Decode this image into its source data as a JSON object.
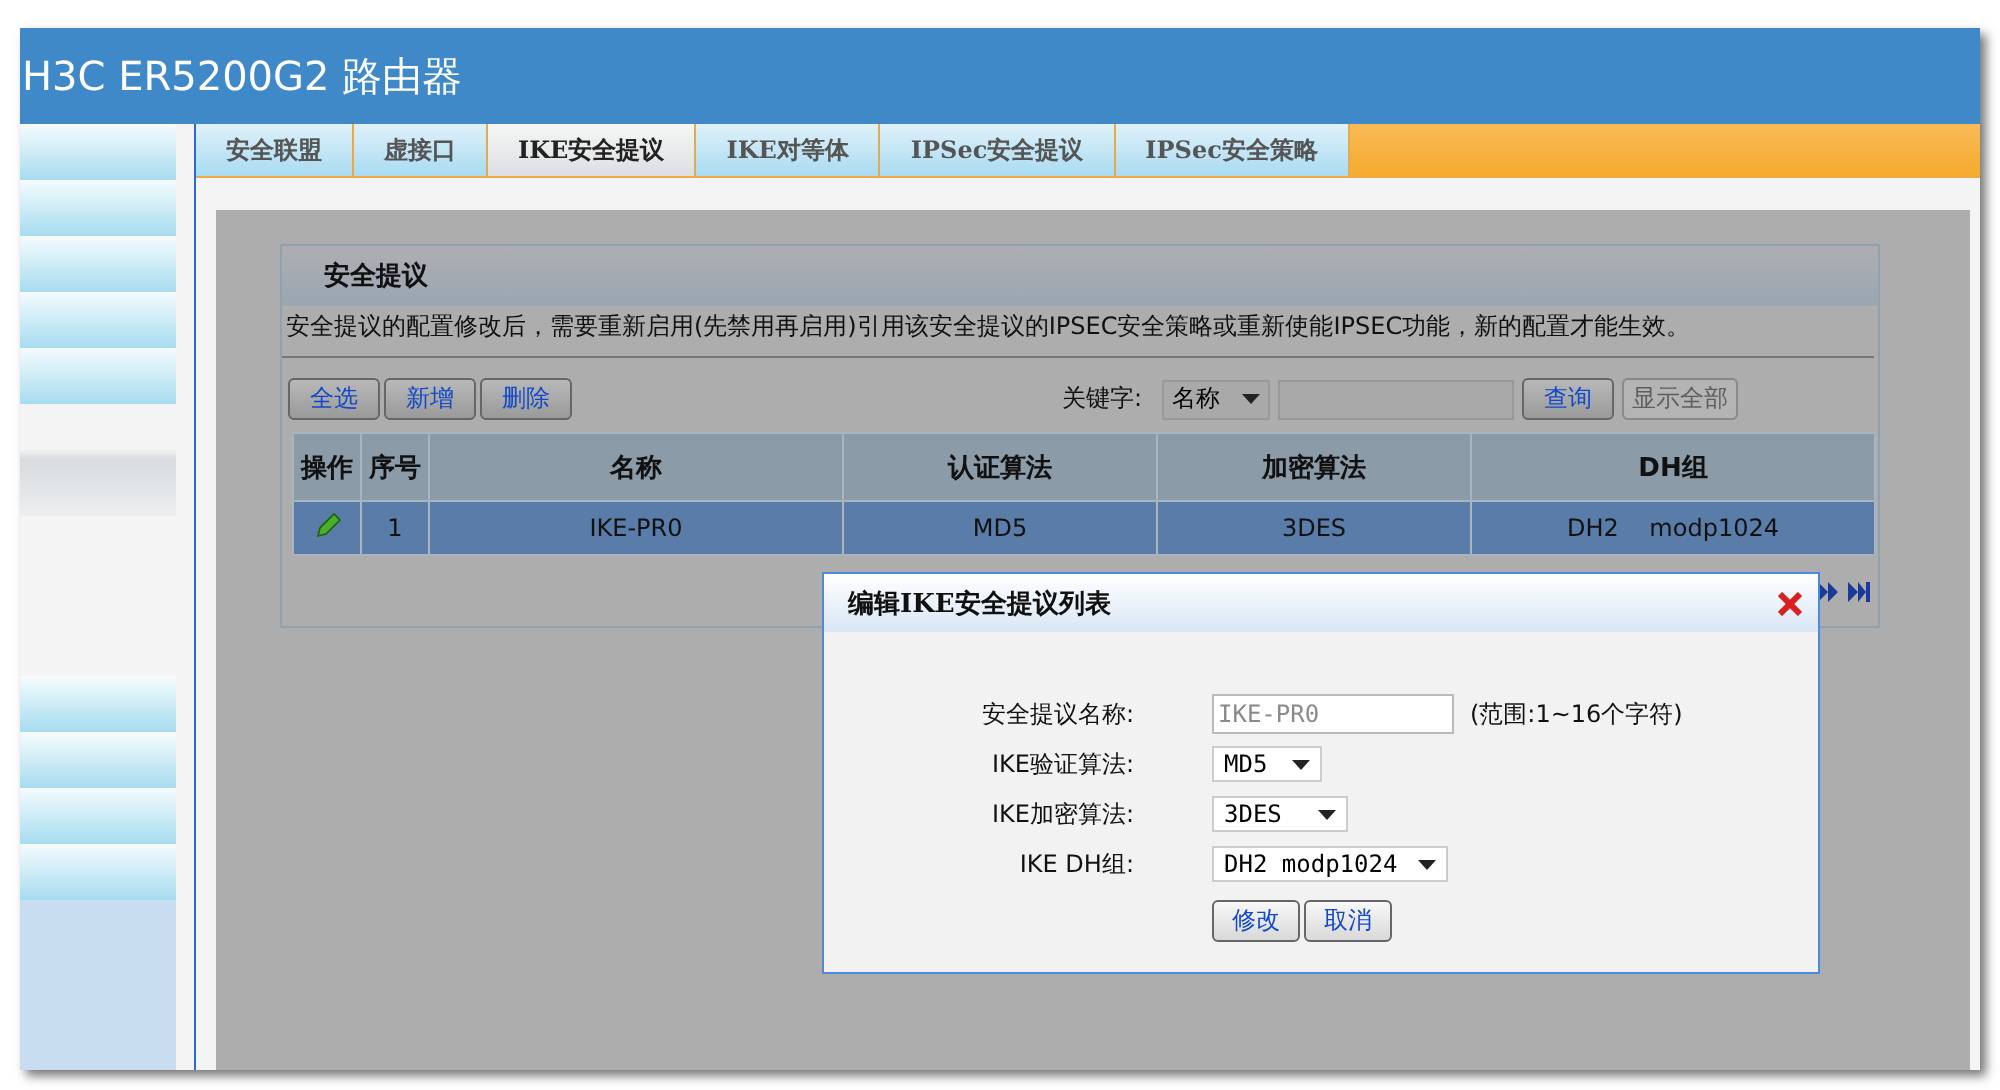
{
  "window": {
    "title": "H3C ER5200G2 路由器"
  },
  "sidebar": {
    "items": [
      {
        "kind": "blue"
      },
      {
        "kind": "blue"
      },
      {
        "kind": "blue"
      },
      {
        "kind": "blue"
      },
      {
        "kind": "blue"
      },
      {
        "kind": "grey"
      },
      {
        "kind": "gap"
      },
      {
        "kind": "blue"
      },
      {
        "kind": "blue"
      },
      {
        "kind": "blue"
      },
      {
        "kind": "blue"
      }
    ]
  },
  "tabs": [
    {
      "label": "安全联盟",
      "selected": false
    },
    {
      "label": "虚接口",
      "selected": false
    },
    {
      "label": "IKE安全提议",
      "selected": true
    },
    {
      "label": "IKE对等体",
      "selected": false
    },
    {
      "label": "IPSec安全提议",
      "selected": false
    },
    {
      "label": "IPSec安全策略",
      "selected": false
    }
  ],
  "panel": {
    "title": "安全提议",
    "notice": "安全提议的配置修改后，需要重新启用(先禁用再启用)引用该安全提议的IPSEC安全策略或重新使能IPSEC功能，新的配置才能生效。",
    "buttons": [
      {
        "label": "全选"
      },
      {
        "label": "新增"
      },
      {
        "label": "删除"
      }
    ],
    "search": {
      "label": "关键字:",
      "field": "名称",
      "query_button": {
        "label": "查询",
        "disabled": false
      },
      "show_all_button": {
        "label": "显示全部",
        "disabled": true
      }
    },
    "table": {
      "columns": [
        "操作",
        "序号",
        "名称",
        "认证算法",
        "加密算法",
        "DH组"
      ],
      "rows": [
        {
          "selected": true,
          "kind": "editable",
          "number": "1",
          "name": "IKE-PR0",
          "authentication": "MD5",
          "encryption": "3DES",
          "dh_group": "DH2    modp1024"
        }
      ]
    }
  },
  "dialog": {
    "title": "编辑IKE安全提议列表",
    "fields": [
      {
        "kind": "text",
        "label": "安全提议名称:",
        "value": "IKE-PR0",
        "disabled": true,
        "hint": "(范围:1~16个字符)"
      },
      {
        "kind": "select",
        "label": "IKE验证算法:",
        "value": "MD5"
      },
      {
        "kind": "select",
        "label": "IKE加密算法:",
        "value": "3DES"
      },
      {
        "kind": "select",
        "label": "IKE DH组:",
        "value": "DH2 modp1024"
      }
    ],
    "buttons": [
      {
        "label": "修改"
      },
      {
        "label": "取消"
      }
    ]
  }
}
